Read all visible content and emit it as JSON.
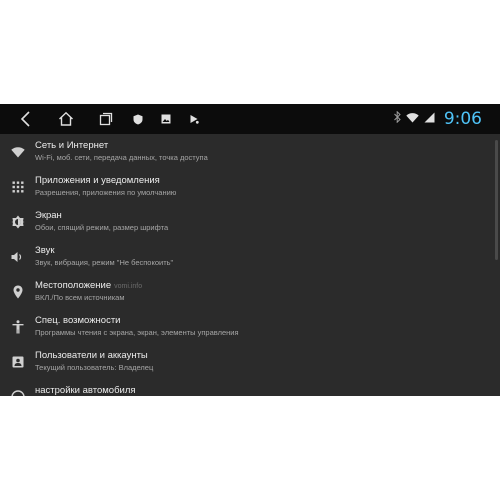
{
  "status": {
    "time": "9:06",
    "icons": [
      "bluetooth-icon",
      "wifi-icon",
      "signal-icon"
    ]
  },
  "navbar": {
    "buttons": [
      "back-icon",
      "home-icon",
      "recents-icon",
      "shield-icon",
      "gallery-icon",
      "play-icon"
    ]
  },
  "colors": {
    "background": "#2b2b2b",
    "navbar": "#0c0c0c",
    "clock": "#4fc3f7",
    "title": "#ececec",
    "subtitle": "#a6a6a6"
  },
  "settings": {
    "items": [
      {
        "icon": "wifi-icon",
        "title": "Сеть и Интернет",
        "subtitle": "Wi-Fi, моб. сети, передача данных, точка доступа"
      },
      {
        "icon": "apps-grid-icon",
        "title": "Приложения и уведомления",
        "subtitle": "Разрешения, приложения по умолчанию"
      },
      {
        "icon": "brightness-icon",
        "title": "Экран",
        "subtitle": "Обои, спящий режим, размер шрифта"
      },
      {
        "icon": "volume-icon",
        "title": "Звук",
        "subtitle": "Звук, вибрация, режим \"Не беспокоить\""
      },
      {
        "icon": "location-icon",
        "title": "Местоположение",
        "subtitle": "ВКЛ./По всем источникам",
        "watermark": "vomi.info"
      },
      {
        "icon": "accessibility-icon",
        "title": "Спец. возможности",
        "subtitle": "Программы чтения с экрана, экран, элементы управления"
      },
      {
        "icon": "account-icon",
        "title": "Пользователи и аккаунты",
        "subtitle": "Текущий пользователь: Владелец"
      },
      {
        "icon": "car-icon",
        "title": "настройки автомобиля",
        "subtitle": ""
      }
    ]
  }
}
